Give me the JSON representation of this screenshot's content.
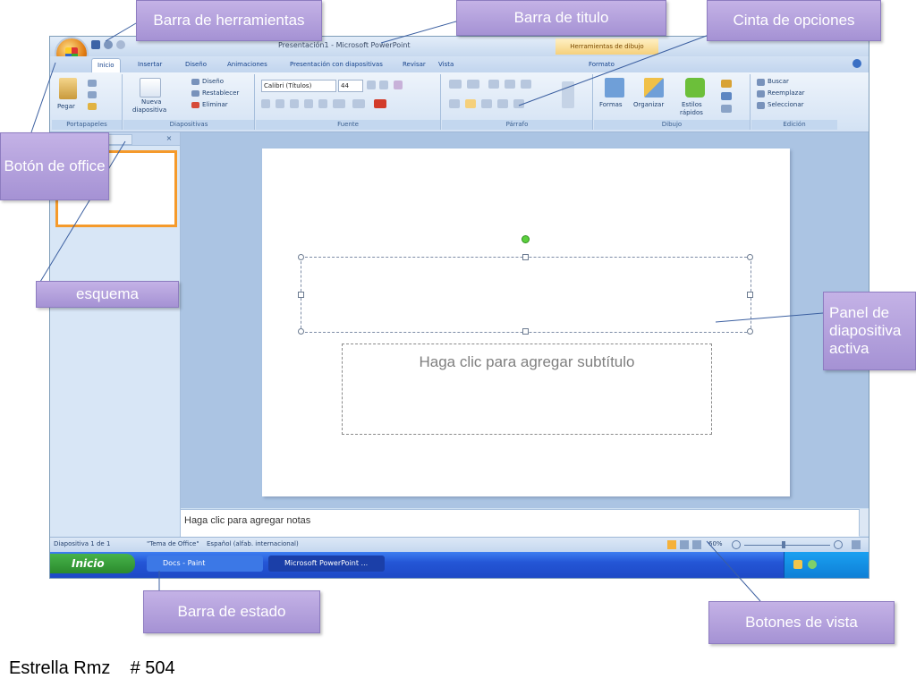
{
  "window": {
    "title": "Presentación1 - Microsoft PowerPoint",
    "contextual_tab": "Herramientas de dibujo"
  },
  "tabs": [
    "Inicio",
    "Insertar",
    "Diseño",
    "Animaciones",
    "Presentación con diapositivas",
    "Revisar",
    "Vista",
    "Formato"
  ],
  "ribbon": {
    "portapapeles": {
      "label": "Portapapeles",
      "pegar": "Pegar"
    },
    "diapositivas": {
      "label": "Diapositivas",
      "nueva": "Nueva",
      "nueva2": "diapositiva",
      "diseno": "Diseño",
      "restablecer": "Restablecer",
      "eliminar": "Eliminar"
    },
    "fuente": {
      "label": "Fuente",
      "font": "Calibri (Títulos)",
      "size": "44"
    },
    "parrafo": {
      "label": "Párrafo"
    },
    "dibujo": {
      "label": "Dibujo",
      "formas": "Formas",
      "organizar": "Organizar",
      "estilos": "Estilos",
      "estilos2": "rápidos"
    },
    "edicion": {
      "label": "Edición",
      "buscar": "Buscar",
      "reemplazar": "Reemplazar",
      "seleccionar": "Seleccionar"
    }
  },
  "slide": {
    "subtitle_placeholder": "Haga clic para agregar subtítulo"
  },
  "notes": {
    "placeholder": "Haga clic para agregar notas"
  },
  "statusbar": {
    "slide": "Diapositiva 1 de 1",
    "theme": "\"Tema de Office\"",
    "language": "Español (alfab. internacional)",
    "zoom": "60%"
  },
  "taskbar": {
    "start": "Inicio",
    "task1": "Docs - Paint",
    "task2": "Microsoft PowerPoint ..."
  },
  "callouts": {
    "barra_herramientas": "Barra de herramientas",
    "barra_titulo": "Barra de titulo",
    "cinta": "Cinta de opciones",
    "boton_office": "Botón de office",
    "esquema": "esquema",
    "panel": "Panel de diapositiva activa",
    "barra_estado": "Barra de estado",
    "botones_vista": "Botones de vista"
  },
  "footer": {
    "author": "Estrella Rmz",
    "number": "# 504"
  }
}
